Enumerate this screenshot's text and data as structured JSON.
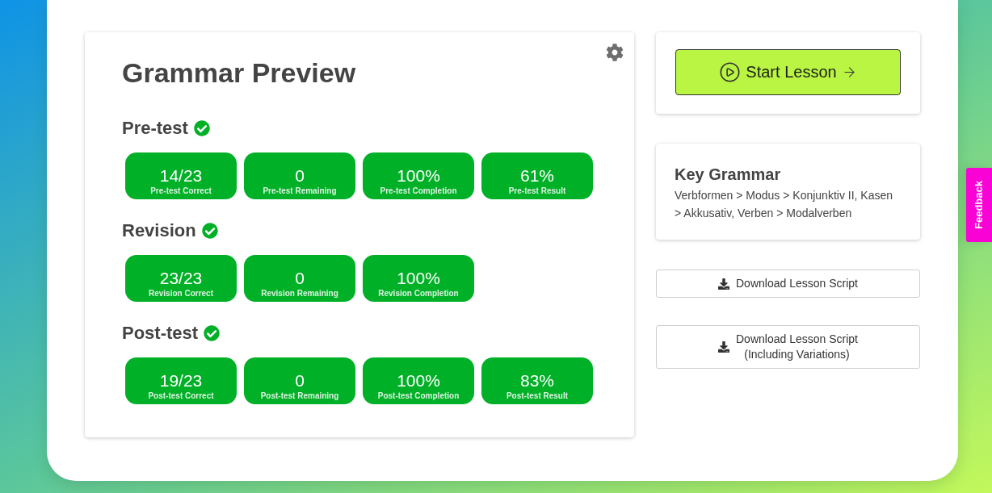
{
  "title": "Grammar Preview",
  "sections": [
    {
      "heading": "Pre-test",
      "completed": true,
      "stats": [
        {
          "value": "14/23",
          "label": "Pre-test Correct"
        },
        {
          "value": "0",
          "label": "Pre-test Remaining"
        },
        {
          "value": "100%",
          "label": "Pre-test Completion"
        },
        {
          "value": "61%",
          "label": "Pre-test Result"
        }
      ]
    },
    {
      "heading": "Revision",
      "completed": true,
      "stats": [
        {
          "value": "23/23",
          "label": "Revision Correct"
        },
        {
          "value": "0",
          "label": "Revision Remaining"
        },
        {
          "value": "100%",
          "label": "Revision Completion"
        }
      ]
    },
    {
      "heading": "Post-test",
      "completed": true,
      "stats": [
        {
          "value": "19/23",
          "label": "Post-test Correct"
        },
        {
          "value": "0",
          "label": "Post-test Remaining"
        },
        {
          "value": "100%",
          "label": "Post-test Completion"
        },
        {
          "value": "83%",
          "label": "Post-test Result"
        }
      ]
    }
  ],
  "start_button": {
    "label": "Start Lesson"
  },
  "key_grammar": {
    "title": "Key Grammar",
    "text": "Verbformen > Modus > Konjunktiv II, Kasen > Akkusativ, Verben > Modalverben"
  },
  "downloads": [
    {
      "label": "Download Lesson Script"
    },
    {
      "label": "Download Lesson Script",
      "note": "(Including Variations)"
    }
  ],
  "feedback_tab": {
    "label": "Feedback"
  }
}
